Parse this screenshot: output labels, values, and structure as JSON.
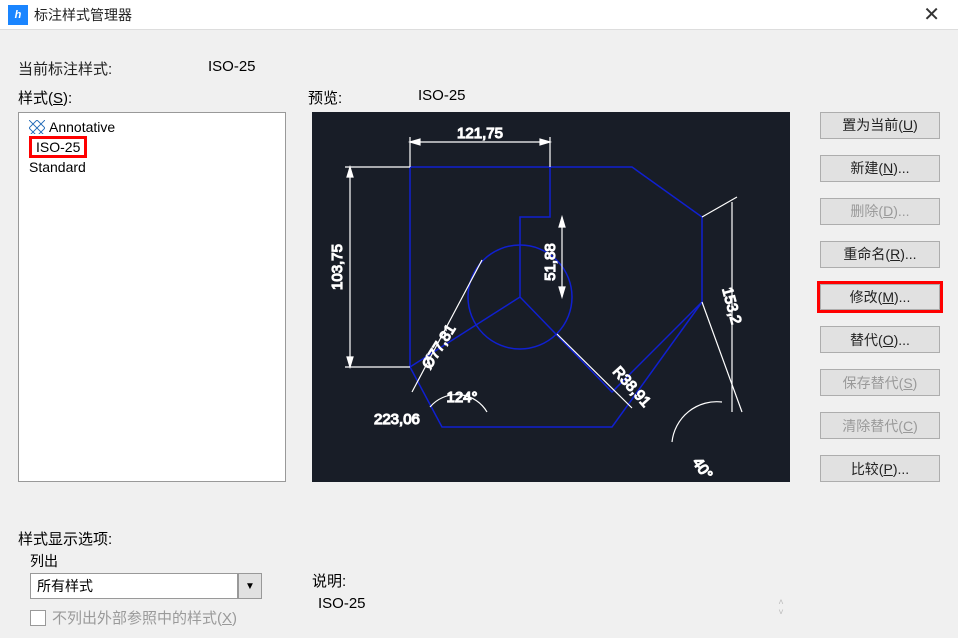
{
  "window": {
    "title": "标注样式管理器"
  },
  "labels": {
    "current_style": "当前标注样式:",
    "styles": "样式(S):",
    "preview": "预览:",
    "display_options": "样式显示选项:",
    "list_out": "列出",
    "external_ref": "不列出外部参照中的样式(X)",
    "description": "说明:"
  },
  "current_style_value": "ISO-25",
  "preview_style_name": "ISO-25",
  "styles_list": {
    "items": [
      {
        "label": "Annotative",
        "icon": true
      },
      {
        "label": "ISO-25",
        "highlighted": true
      },
      {
        "label": "Standard"
      }
    ]
  },
  "combo": {
    "selected": "所有样式"
  },
  "description_value": "ISO-25",
  "buttons": {
    "set_current": "置为当前(U)",
    "new": "新建(N)...",
    "delete": "删除(D)...",
    "rename": "重命名(R)...",
    "modify": "修改(M)...",
    "override": "替代(O)...",
    "save_override": "保存替代(S)",
    "clear_override": "清除替代(C)",
    "compare": "比较(P)..."
  },
  "preview_dims": {
    "d1": "121,75",
    "d2": "103,75",
    "d3": "51,88",
    "d4": "153,2",
    "d5": "Ø77,81",
    "d6": "R38,91",
    "d7": "124°",
    "d8": "223,06",
    "d9": "40°"
  }
}
